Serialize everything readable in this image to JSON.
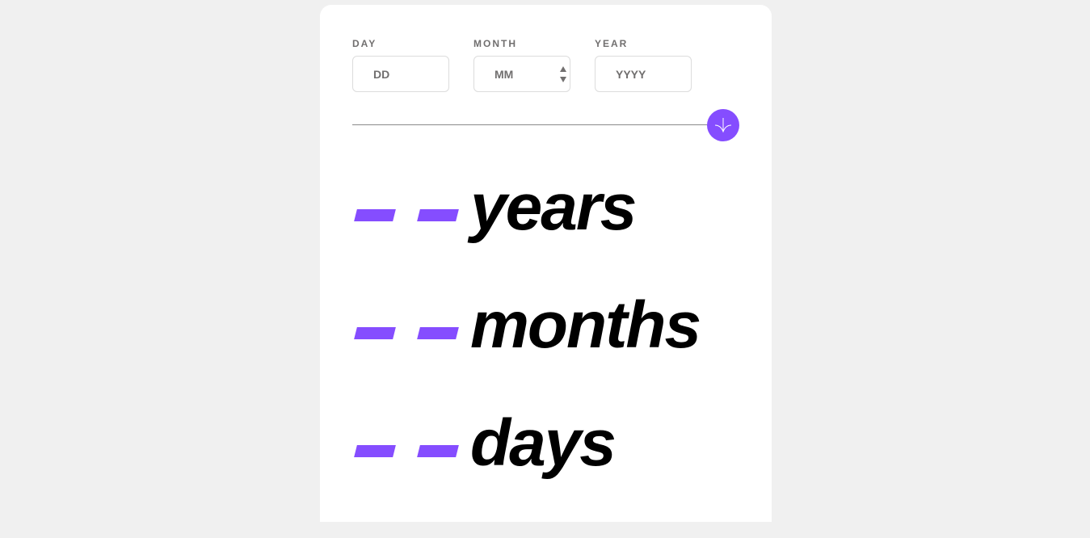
{
  "form": {
    "day": {
      "label": "DAY",
      "placeholder": "DD"
    },
    "month": {
      "label": "MONTH",
      "placeholder": "MM"
    },
    "year": {
      "label": "YEAR",
      "placeholder": "YYYY"
    }
  },
  "submit_icon": "arrow-down-icon",
  "results": [
    {
      "value": "- -",
      "unit": "years"
    },
    {
      "value": "- -",
      "unit": "months"
    },
    {
      "value": "- -",
      "unit": "days"
    }
  ],
  "colors": {
    "accent": "#854dff",
    "background": "#f0f0f0",
    "card": "#ffffff",
    "label": "#716f6f",
    "text": "#000000"
  }
}
